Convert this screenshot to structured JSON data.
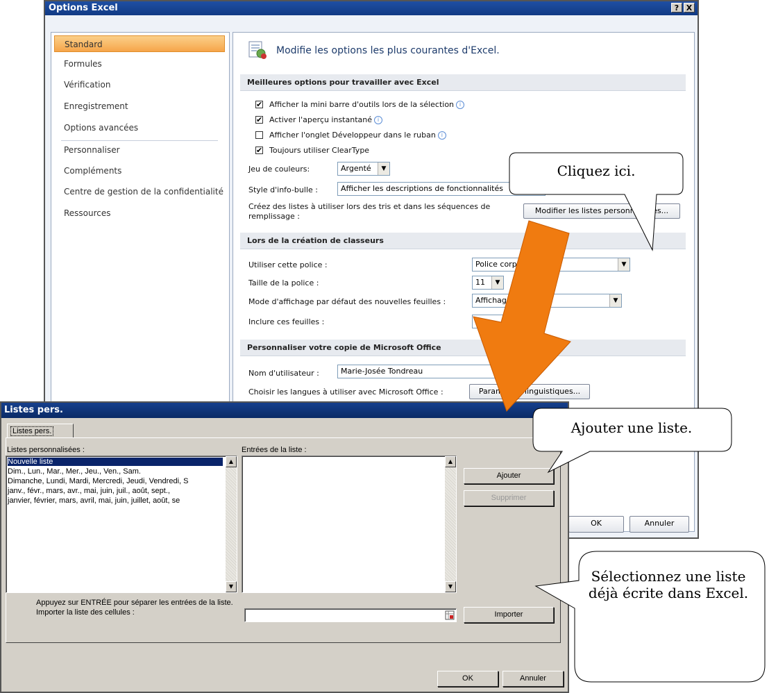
{
  "options_window": {
    "title": "Options Excel",
    "help_btn": "?",
    "close_btn": "X",
    "nav": [
      "Standard",
      "Formules",
      "Vérification",
      "Enregistrement",
      "Options avancées",
      "Personnaliser",
      "Compléments",
      "Centre de gestion de la confidentialité",
      "Ressources"
    ],
    "header_title": "Modifie les options les plus courantes d'Excel.",
    "section1": "Meilleures options pour travailler avec Excel",
    "checkboxes": [
      {
        "label": "Afficher la mini barre d'outils lors de la sélection",
        "checked": true
      },
      {
        "label": "Activer l'aperçu instantané",
        "checked": true
      },
      {
        "label": "Afficher l'onglet Développeur dans le ruban",
        "checked": false
      },
      {
        "label": "Toujours utiliser ClearType",
        "checked": true
      }
    ],
    "check_mark": "✔",
    "color_label": "Jeu de couleurs:",
    "color_value": "Argenté",
    "tooltip_label": "Style d'info-bulle :",
    "tooltip_value": "Afficher les descriptions de fonctionnalités",
    "lists_text": "Créez des listes à utiliser lors des tris et dans les séquences de remplissage :",
    "lists_button": "Modifier les listes personnalisées...",
    "section2": "Lors de la création de classeurs",
    "font_label": "Utiliser cette police :",
    "font_value": "Police corps",
    "size_label": "Taille de la police :",
    "size_value": "11",
    "view_label": "Mode d'affichage par défaut des nouvelles feuilles :",
    "view_value": "Affichage",
    "sheets_label": "Inclure ces feuilles :",
    "sheets_value": "3",
    "section3": "Personnaliser votre copie de Microsoft Office",
    "user_label": "Nom d'utilisateur :",
    "user_value": "Marie-Josée Tondreau",
    "lang_label": "Choisir les langues à utiliser avec Microsoft Office :",
    "lang_button": "Paramètres linguistiques...",
    "ok": "OK",
    "cancel": "Annuler"
  },
  "lists_dialog": {
    "title": "Listes pers.",
    "tab": "Listes pers.",
    "custom_lists_label": "Listes personnalisées :",
    "entries_label": "Entrées de la liste :",
    "lists": [
      "Nouvelle liste",
      "Dim., Lun., Mar., Mer., Jeu., Ven., Sam.",
      "Dimanche, Lundi, Mardi, Mercredi, Jeudi, Vendredi, S",
      "janv., févr., mars, avr., mai, juin, juil., août, sept.,",
      "janvier, février, mars, avril, mai, juin, juillet, août, se"
    ],
    "add_button": "Ajouter",
    "delete_button": "Supprimer",
    "hint": "Appuyez sur ENTRÉE pour séparer les entrées de la liste.",
    "import_label": "Importer la liste des cellules :",
    "import_value": "",
    "import_button": "Importer",
    "ok": "OK",
    "cancel": "Annuler",
    "scroll_up": "▲",
    "scroll_down": "▼"
  },
  "callouts": {
    "click_here": "Cliquez ici.",
    "add_list": "Ajouter une liste.",
    "select_list": "Sélectionnez une liste déjà écrite dans Excel."
  },
  "colors": {
    "arrow": "#f07b10",
    "nav_selected": "#f6a54a",
    "title_bar": "#1f4fa3"
  }
}
